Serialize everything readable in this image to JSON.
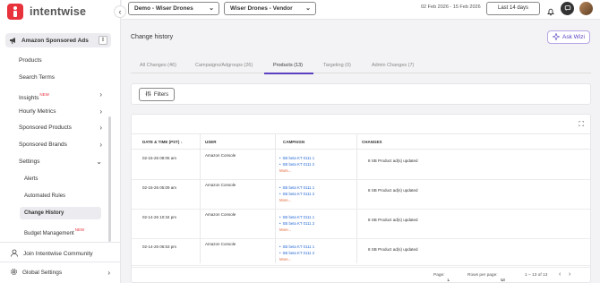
{
  "app": {
    "logo_text": "intentwise"
  },
  "topbar": {
    "account": "Demo - Wiser Drones",
    "profile": "Wiser Drones - Vendor",
    "date_range": "02 Feb 2026 - 15 Feb 2026",
    "range_button": "Last 14 days"
  },
  "sidebar": {
    "module": "Amazon Sponsored Ads",
    "items": [
      {
        "label": "Products"
      },
      {
        "label": "Search Terms"
      },
      {
        "label": "Insights",
        "badge": "NEW"
      },
      {
        "label": "Hourly Metrics"
      },
      {
        "label": "Sponsored Products"
      },
      {
        "label": "Sponsored Brands"
      },
      {
        "label": "Settings"
      }
    ],
    "settings_sub": [
      {
        "label": "Alerts"
      },
      {
        "label": "Automated Rules"
      },
      {
        "label": "Change History"
      },
      {
        "label": "Budget Management",
        "badge": "NEW"
      }
    ],
    "community": "Join Intentwise Community",
    "global_settings": "Global Settings"
  },
  "page": {
    "title": "Change history",
    "ask_wizi": "Ask Wizi",
    "tabs": [
      {
        "label": "All Changes (46)"
      },
      {
        "label": "Campaigns/Adgroups (26)"
      },
      {
        "label": "Products (13)"
      },
      {
        "label": "Targeting (0)"
      },
      {
        "label": "Admin Changes (7)"
      }
    ],
    "filters_label": "Filters"
  },
  "table": {
    "headers": [
      "DATE & TIME (PST)",
      "USER",
      "CAMPAIGN",
      "CHANGES"
    ],
    "rows": [
      {
        "date": "02-15-26 08:05 am",
        "user": "Amazon Console",
        "campaigns": [
          "SB beta KT 0111 1",
          "SB beta KT 0111 2"
        ],
        "more": "More...",
        "change": "8 SB Product ad(s) updated"
      },
      {
        "date": "02-15-26 05:09 am",
        "user": "Amazon Console",
        "campaigns": [
          "SB beta KT 0111 1",
          "SB beta KT 0111 2"
        ],
        "more": "More...",
        "change": "8 SB Product ad(s) updated"
      },
      {
        "date": "02-14-26 10:34 pm",
        "user": "Amazon Console",
        "campaigns": [
          "SB beta KT 0111 1",
          "SB beta KT 0111 2"
        ],
        "more": "More...",
        "change": "8 SB Product ad(s) updated"
      },
      {
        "date": "02-14-26 06:53 pm",
        "user": "Amazon Console",
        "campaigns": [
          "SB beta KT 0111 1",
          "SB beta KT 0111 2"
        ],
        "more": "More...",
        "change": "8 SB Product ad(s) updated"
      }
    ],
    "pagination": {
      "page_label": "Page:",
      "page_value": "1",
      "rows_label": "Rows per page:",
      "rows_value": "50",
      "range": "1 – 13 of 13"
    }
  },
  "colors": {
    "brand": "#e8323c",
    "accent": "#5a3fc0",
    "link": "#2a6bd6"
  }
}
